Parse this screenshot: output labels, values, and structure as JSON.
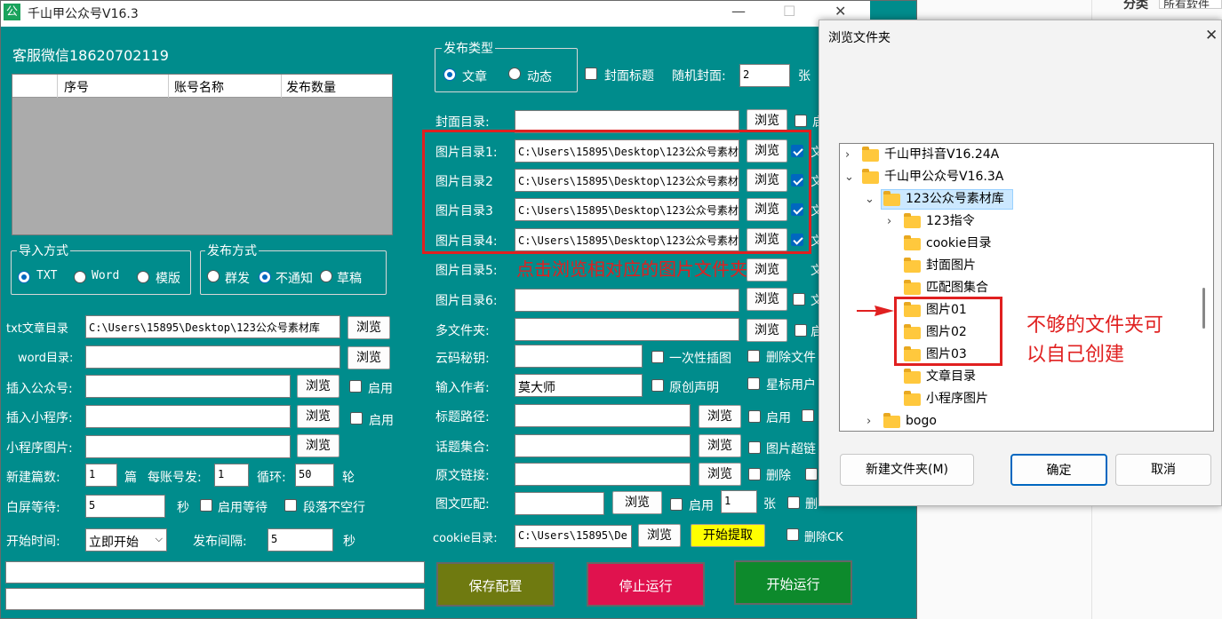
{
  "app": {
    "title": "千山甲公众号V16.3",
    "icon_char": "公",
    "service": "客服微信18620702119",
    "minimize": "—",
    "maximize": "☐",
    "close": "✕"
  },
  "table": {
    "columns": [
      "序号",
      "账号名称",
      "发布数量"
    ]
  },
  "import_group": {
    "title": "导入方式",
    "options": [
      "TXT",
      "Word",
      "模版"
    ],
    "selected": "TXT"
  },
  "publish_group": {
    "title": "发布方式",
    "options": [
      "群发",
      "不通知",
      "草稿"
    ],
    "selected": "不通知"
  },
  "left_form": {
    "txt_label": "txt文章目录",
    "txt_value": "C:\\Users\\15895\\Desktop\\123公众号素材库",
    "word_label": "word目录:",
    "insert_gzh_label": "插入公众号:",
    "insert_mini_label": "插入小程序:",
    "mini_img_label": "小程序图片:",
    "new_count_label": "新建篇数:",
    "new_count": "1",
    "unit_pian": "篇",
    "per_account_label": "每账号发:",
    "per_account": "1",
    "loop_label": "循环:",
    "loop": "50",
    "unit_lun": "轮",
    "white_wait_label": "白屏等待:",
    "white_wait": "5",
    "unit_sec": "秒",
    "enable_wait": "启用等待",
    "no_blank_para": "段落不空行",
    "start_time_label": "开始时间:",
    "start_time": "立即开始",
    "interval_label": "发布间隔:",
    "interval": "5",
    "unit_sec2": "秒",
    "enable": "启用",
    "browse": "浏览"
  },
  "publish_type": {
    "title": "发布类型",
    "options": [
      "文章",
      "动态"
    ],
    "selected": "文章",
    "cover_title": "封面标题",
    "random_cover_label": "随机封面:",
    "random_cover": "2",
    "unit_zhang": "张"
  },
  "right_form": {
    "cover_dir": "封面目录:",
    "img_dirs": [
      "图片目录1:",
      "图片目录2",
      "图片目录3",
      "图片目录4:",
      "图片目录5:",
      "图片目录6:"
    ],
    "img_value": "C:\\Users\\15895\\Desktop\\123公众号素材库",
    "multi_folder": "多文件夹:",
    "yunma": "云码秘钥:",
    "once_insert": "一次性插图",
    "delete_file": "删除文件",
    "author_label": "输入作者:",
    "author": "莫大师",
    "original": "原创声明",
    "star_user": "星标用户",
    "title_path": "标题路径:",
    "topic": "话题集合:",
    "img_link": "图片超链",
    "orig_link": "原文链接:",
    "delete": "删除",
    "img_match": "图文匹配:",
    "cookie_label": "cookie目录:",
    "cookie_value": "C:\\Users\\15895\\De",
    "fetch": "开始提取",
    "delete_ck": "删除CK",
    "enable": "启用",
    "browse": "浏览",
    "unit_zhang": "张",
    "trunc_qi": "启",
    "trunc_wen": "文",
    "trunc_shan": "删",
    "count1": "1"
  },
  "annotation": "点击浏览相对应的图片文件夹",
  "buttons": {
    "save": "保存配置",
    "stop": "停止运行",
    "start": "开始运行"
  },
  "dialog": {
    "title": "浏览文件夹",
    "close": "✕",
    "tree": [
      {
        "label": "千山甲抖音V16.24A",
        "arrow": "›"
      },
      {
        "label": "千山甲公众号V16.3A",
        "arrow": "⌄"
      },
      {
        "label": "123公众号素材库",
        "arrow": "⌄"
      },
      {
        "label": "123指令",
        "arrow": "›"
      },
      {
        "label": "cookie目录"
      },
      {
        "label": "封面图片"
      },
      {
        "label": "匹配图集合"
      },
      {
        "label": "图片01"
      },
      {
        "label": "图片02"
      },
      {
        "label": "图片03"
      },
      {
        "label": "文章目录"
      },
      {
        "label": "小程序图片"
      },
      {
        "label": "bogo",
        "arrow": "›"
      }
    ],
    "new_folder": "新建文件夹(M)",
    "ok": "确定",
    "cancel": "取消",
    "note_line1": "不够的文件夹可",
    "note_line2": "以自己创建"
  },
  "background": {
    "label1": "分类",
    "label2": "所有软件",
    "close": "✕"
  },
  "colors": {
    "teal": "#008c8c",
    "save": "#6f7a10",
    "stop": "#e0124e",
    "start": "#0d8a2c",
    "annot": "#e02020",
    "fetch": "#ffff00"
  }
}
